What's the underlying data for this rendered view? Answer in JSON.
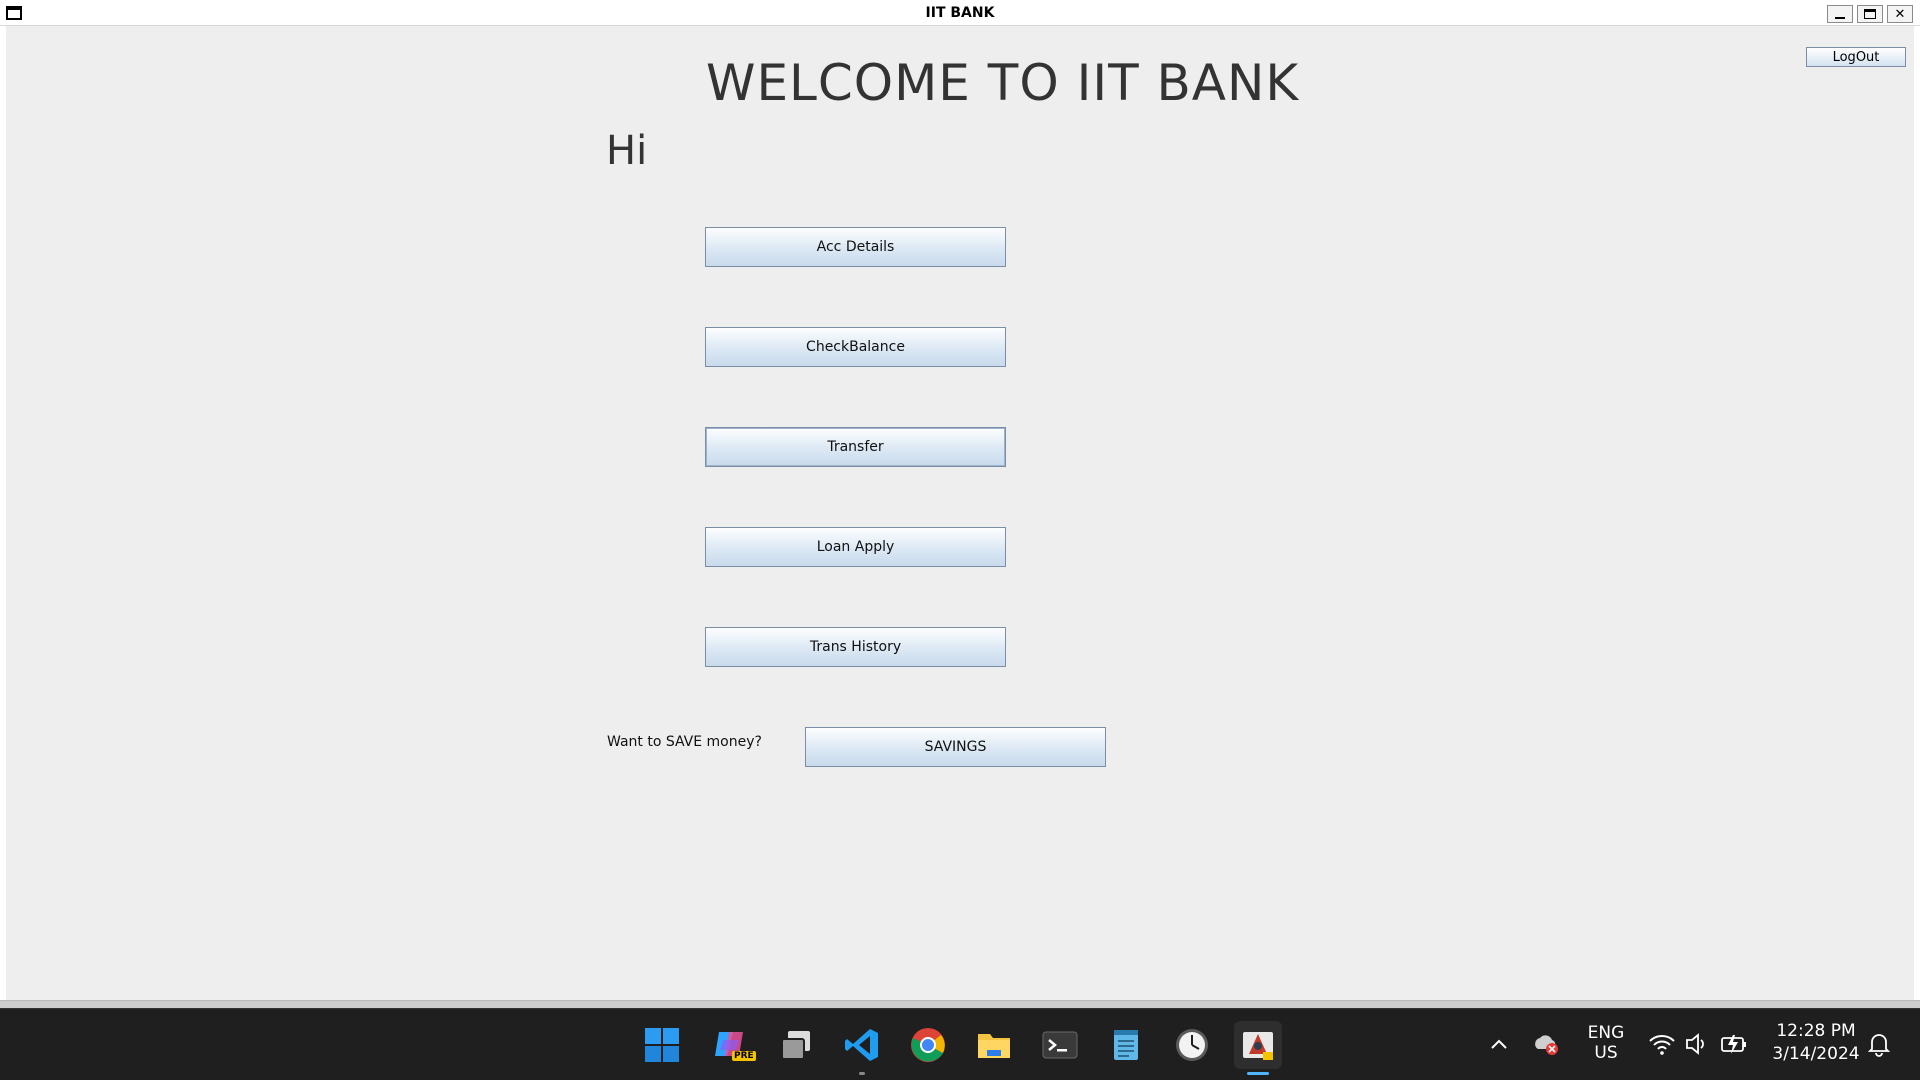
{
  "window": {
    "title": "IIT BANK"
  },
  "main": {
    "welcome": "WELCOME TO IIT BANK",
    "greeting": "Hi",
    "logout_label": "LogOut",
    "buttons": {
      "acc_details": "Acc Details",
      "check_balance": "CheckBalance",
      "transfer": "Transfer",
      "loan_apply": "Loan Apply",
      "trans_history": "Trans History",
      "savings": "SAVINGS"
    },
    "save_prompt": "Want to SAVE money?"
  },
  "taskbar": {
    "language": "ENG",
    "region": "US",
    "time": "12:28 PM",
    "date": "3/14/2024",
    "pinned": [
      "windows-start-icon",
      "copilot-icon",
      "task-view-icon",
      "vscode-icon",
      "chrome-icon",
      "file-explorer-icon",
      "terminal-icon",
      "notepad-icon",
      "clock-icon",
      "java-app-icon"
    ],
    "badge_pre": "PRE"
  },
  "colors": {
    "button_border": "#7a8ea6",
    "button_gradient_top": "#fdfeff",
    "button_gradient_bottom": "#c8daec",
    "taskbar_bg": "#1f1f1f",
    "window_bg": "#eeeeee",
    "active_indicator": "#4fb3ff"
  }
}
